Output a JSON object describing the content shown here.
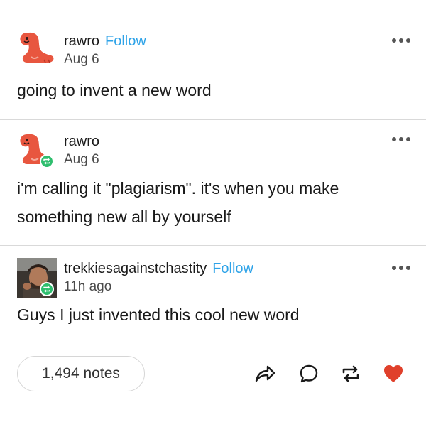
{
  "posts": [
    {
      "username": "rawro",
      "follow_label": "Follow",
      "date": "Aug 6",
      "text": "going to invent a new word"
    },
    {
      "username": "rawro",
      "date": "Aug 6",
      "text": "i'm calling it \"plagiarism\". it's when you make something new all by yourself"
    },
    {
      "username": "trekkiesagainstchastity",
      "follow_label": "Follow",
      "date": "11h ago",
      "text": "Guys I just invented this cool new word"
    }
  ],
  "footer": {
    "notes_label": "1,494 notes"
  },
  "colors": {
    "follow": "#2ea3e8",
    "reblog_badge": "#2fbe6e",
    "like": "#e0402b",
    "avatar_dino": "#e8563f"
  },
  "icons": [
    "more-icon",
    "reblog-badge-icon",
    "share-icon",
    "reply-icon",
    "reblog-icon",
    "heart-icon"
  ]
}
